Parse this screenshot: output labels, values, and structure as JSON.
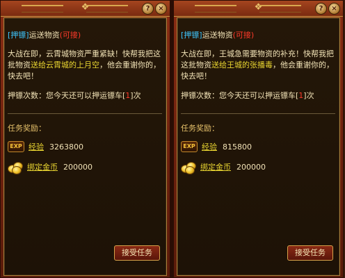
{
  "panels": [
    {
      "help_label": "?",
      "close_label": "×",
      "tag": "[押镖]",
      "title": "运送物资",
      "status": "(可接)",
      "desc_1": "大战在即，云霄城物资严重紧缺！快帮我把这批物资",
      "desc_hl": "送给云霄城的上月空",
      "desc_2": "，他会重谢你的，快去吧！",
      "count_label": "押镖次数：",
      "count_text_1": "您今天还可以押运镖车[",
      "count_num": "1",
      "count_text_2": "]次",
      "reward_title": "任务奖励：",
      "exp_icon": "EXP",
      "exp_label": "经验",
      "exp_value": "3263800",
      "gold_label": "绑定金币",
      "gold_value": "200000",
      "accept_label": "接受任务"
    },
    {
      "help_label": "?",
      "close_label": "×",
      "tag": "[押镖]",
      "title": "运送物资",
      "status": "(可接)",
      "desc_1": "大战在即，王城急需要物资的补充！快帮我把这批物资",
      "desc_hl": "送给王城的张播毒",
      "desc_2": "，他会重谢你的，快去吧！",
      "count_label": "押镖次数：",
      "count_text_1": "您今天还可以押运镖车[",
      "count_num": "1",
      "count_text_2": "]次",
      "reward_title": "任务奖励：",
      "exp_icon": "EXP",
      "exp_label": "经验",
      "exp_value": "815800",
      "gold_label": "绑定金币",
      "gold_value": "200000",
      "accept_label": "接受任务"
    }
  ],
  "colors": {
    "tag": "#3fc7ff",
    "status": "#ff3a2a",
    "highlight": "#e9d531",
    "text": "#f1e2b6",
    "frame": "#8a2e14"
  }
}
